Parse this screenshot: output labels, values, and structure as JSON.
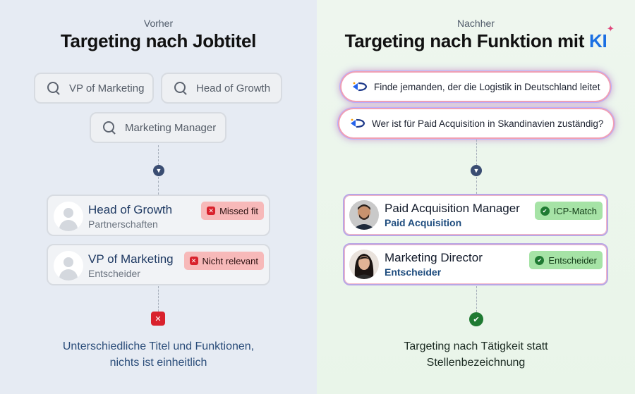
{
  "left": {
    "eyebrow": "Vorher",
    "title": "Targeting nach Jobtitel",
    "chips": [
      "VP of Marketing",
      "Head of Growth",
      "Marketing Manager"
    ],
    "cards": [
      {
        "title": "Head of Growth",
        "subtitle": "Partnerschaften",
        "badge": "Missed fit"
      },
      {
        "title": "VP of Marketing",
        "subtitle": "Entscheider",
        "badge": "Nicht relevant"
      }
    ],
    "conclusion_line1": "Unterschiedliche Titel und Funktionen,",
    "conclusion_line2": "nichts ist einheitlich"
  },
  "right": {
    "eyebrow": "Nachher",
    "title_prefix": "Targeting nach Funktion mit",
    "title_ki": "KI",
    "prompts": [
      "Finde jemanden, der die Logistik in Deutschland leitet",
      "Wer ist für Paid Acquisition in Skandinavien zuständig?"
    ],
    "cards": [
      {
        "title": "Paid Acquisition Manager",
        "subtitle": "Paid Acquisition",
        "badge": "ICP-Match"
      },
      {
        "title": "Marketing Director",
        "subtitle": "Entscheider",
        "badge": "Entscheider"
      }
    ],
    "conclusion_line1": "Targeting nach Tätigkeit statt",
    "conclusion_line2": "Stellenbezeichnung"
  },
  "colors": {
    "ki_accent": "#1a6fe3",
    "bad": "#d9212c",
    "good": "#1f7a32"
  },
  "icons": {
    "chip": "search-icon",
    "prompt": "ai-sparkle-icon",
    "bad": "x-icon",
    "good": "check-icon",
    "connector": "chevron-down-icon"
  }
}
